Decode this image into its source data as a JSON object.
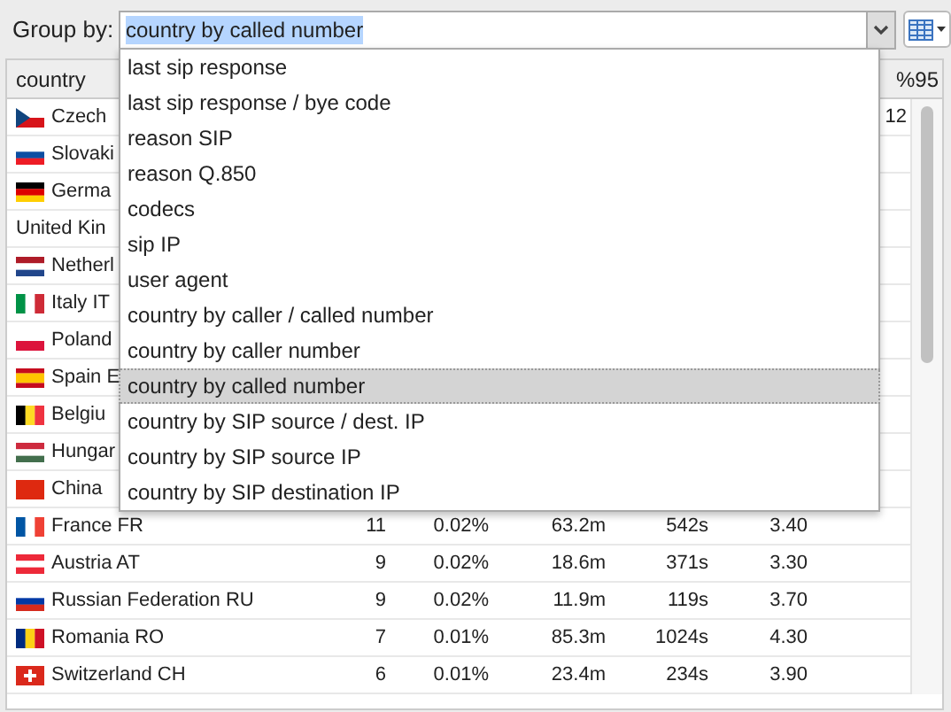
{
  "group_by": {
    "label": "Group by:",
    "value": "country by called number",
    "expanded": true,
    "options": [
      {
        "label": "last sip response",
        "selected": false
      },
      {
        "label": "last sip response / bye code",
        "selected": false
      },
      {
        "label": "reason SIP",
        "selected": false
      },
      {
        "label": "reason Q.850",
        "selected": false
      },
      {
        "label": "codecs",
        "selected": false
      },
      {
        "label": "sip IP",
        "selected": false
      },
      {
        "label": "user agent",
        "selected": false
      },
      {
        "label": "country by caller / called number",
        "selected": false
      },
      {
        "label": "country by caller number",
        "selected": false
      },
      {
        "label": "country by called number",
        "selected": true
      },
      {
        "label": "country by SIP source / dest. IP",
        "selected": false
      },
      {
        "label": "country by SIP source IP",
        "selected": false
      },
      {
        "label": "country by SIP destination IP",
        "selected": false
      }
    ]
  },
  "table": {
    "columns": [
      "country",
      null,
      null,
      null,
      null,
      null,
      "%95"
    ],
    "rows": [
      {
        "cells": [
          "Czech",
          null,
          null,
          null,
          null,
          null,
          "12"
        ]
      },
      {
        "cells": [
          "Slovaki"
        ]
      },
      {
        "cells": [
          "Germa"
        ]
      },
      {
        "cells": [
          "United Kin"
        ]
      },
      {
        "cells": [
          "Netherl"
        ]
      },
      {
        "cells": [
          "Italy IT"
        ]
      },
      {
        "cells": [
          "Poland"
        ]
      },
      {
        "cells": [
          "Spain E"
        ]
      },
      {
        "cells": [
          "Belgiu"
        ]
      },
      {
        "cells": [
          "Hungar"
        ]
      },
      {
        "cells": [
          "China"
        ]
      },
      {
        "cells": [
          "France FR",
          "11",
          "0.02%",
          "63.2m",
          "542s",
          "3.40"
        ]
      },
      {
        "cells": [
          "Austria AT",
          "9",
          "0.02%",
          "18.6m",
          "371s",
          "3.30"
        ]
      },
      {
        "cells": [
          "Russian Federation RU",
          "9",
          "0.02%",
          "11.9m",
          "119s",
          "3.70"
        ]
      },
      {
        "cells": [
          "Romania RO",
          "7",
          "0.01%",
          "85.3m",
          "1024s",
          "4.30"
        ]
      },
      {
        "cells": [
          "Switzerland CH",
          "6",
          "0.01%",
          "23.4m",
          "234s",
          "3.90"
        ]
      }
    ]
  }
}
